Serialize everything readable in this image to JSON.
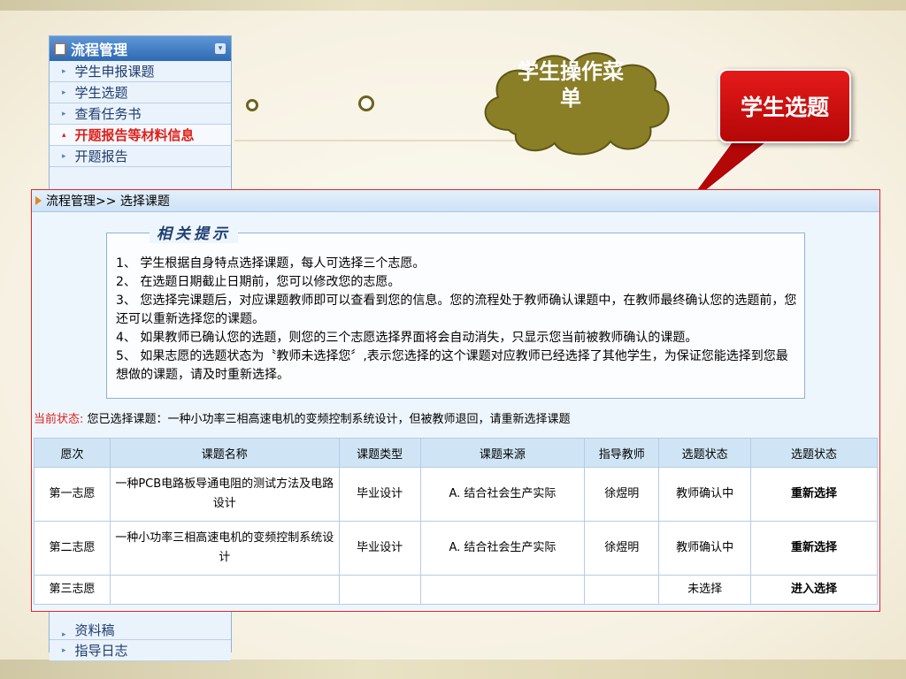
{
  "sidebar": {
    "title": "流程管理",
    "items": [
      {
        "label": "学生申报课题"
      },
      {
        "label": "学生选题"
      },
      {
        "label": "查看任务书"
      },
      {
        "label": "开题报告等材料信息"
      },
      {
        "label": "开题报告"
      }
    ],
    "bottom_items": [
      {
        "label": "资料稿"
      },
      {
        "label": "指导日志"
      }
    ]
  },
  "callouts": {
    "cloud": "学生操作菜单",
    "red": "学生选题"
  },
  "panel": {
    "breadcrumb": "流程管理>> 选择课题",
    "tips_title": "相关提示",
    "tips": [
      "1、 学生根据自身特点选择课题，每人可选择三个志愿。",
      "2、 在选题日期截止日期前，您可以修改您的志愿。",
      "3、 您选择完课题后，对应课题教师即可以查看到您的信息。您的流程处于教师确认课题中，在教师最终确认您的选题前，您还可以重新选择您的课题。",
      "4、 如果教师已确认您的选题，则您的三个志愿选择界面将会自动消失，只显示您当前被教师确认的课题。",
      "5、 如果志愿的选题状态为〝教师未选择您〞,表示您选择的这个课题对应教师已经选择了其他学生，为保证您能选择到您最想做的课题，请及时重新选择。"
    ],
    "status_label": "当前状态:",
    "status_text": "您已选择课题：一种小功率三相高速电机的变频控制系统设计，但被教师退回，请重新选择课题"
  },
  "table": {
    "headers": [
      "愿次",
      "课题名称",
      "课题类型",
      "课题来源",
      "指导教师",
      "选题状态",
      "选题状态"
    ],
    "rows": [
      {
        "rank": "第一志愿",
        "name": "一种PCB电路板导通电阻的测试方法及电路设计",
        "type": "毕业设计",
        "source": "A. 结合社会生产实际",
        "teacher": "徐煜明",
        "state": "教师确认中",
        "action": "重新选择"
      },
      {
        "rank": "第二志愿",
        "name": "一种小功率三相高速电机的变频控制系统设计",
        "type": "毕业设计",
        "source": "A. 结合社会生产实际",
        "teacher": "徐煜明",
        "state": "教师确认中",
        "action": "重新选择"
      },
      {
        "rank": "第三志愿",
        "name": "",
        "type": "",
        "source": "",
        "teacher": "",
        "state": "未选择",
        "action": "进入选择"
      }
    ]
  },
  "colors": {
    "accent_red": "#e0201b",
    "menu_blue": "#2e69b3",
    "cloud_olive": "#8a7e27"
  }
}
